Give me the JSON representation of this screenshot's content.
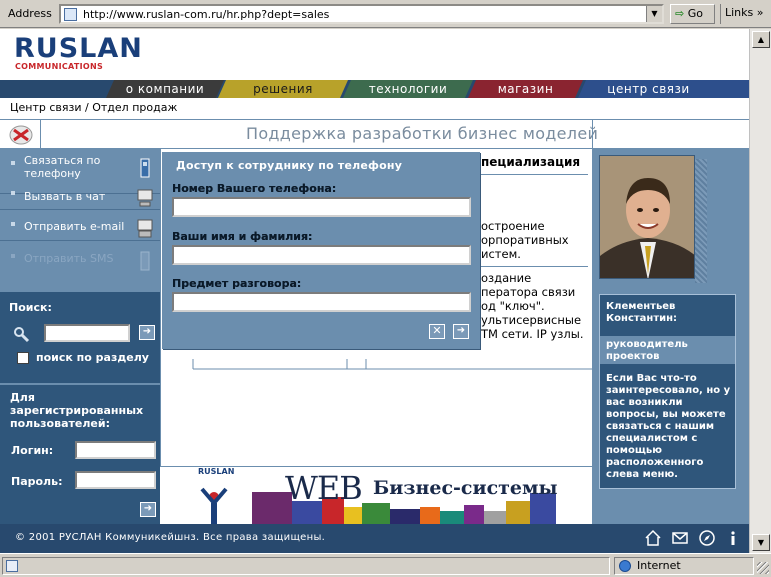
{
  "browser": {
    "address_label": "Address",
    "url": "http://www.ruslan-com.ru/hr.php?dept=sales",
    "go_label": "Go",
    "links_label": "Links",
    "status_text": "",
    "zone_label": "Internet"
  },
  "header": {
    "logo_main": "RUSLAN",
    "logo_sub": "COMMUNICATIONS"
  },
  "nav": {
    "tabs": [
      {
        "label": "о компании",
        "color": "#3b3b3b"
      },
      {
        "label": "решения",
        "color": "#b8a22a"
      },
      {
        "label": "технологии",
        "color": "#3d6b4e"
      },
      {
        "label": "магазин",
        "color": "#8a2430"
      },
      {
        "label": "центр связи",
        "color": "#2d4f8c"
      }
    ]
  },
  "breadcrumb": "Центр связи / Отдел продаж",
  "page_title": "Поддержка разработки бизнес моделей",
  "sidebar": {
    "links": [
      {
        "label": "Связаться по телефону"
      },
      {
        "label": "Вызвать в чат"
      },
      {
        "label": "Отправить e-mail"
      },
      {
        "label": "Отправить SMS"
      }
    ],
    "search": {
      "label": "Поиск:",
      "value": "",
      "section_label": "поиск по разделу"
    },
    "login": {
      "title": "Для зарегистрированных пользователей:",
      "login_label": "Логин:",
      "password_label": "Пароль:"
    }
  },
  "popup": {
    "title": "Доступ к сотруднику по телефону",
    "phone_label": "Номер Вашего телефона:",
    "name_label": "Ваши имя и фамилия:",
    "subject_label": "Предмет разговора:",
    "phone_value": "",
    "name_value": "",
    "subject_value": ""
  },
  "specialization": {
    "header": "пециализация",
    "item1": "остроение орпоративных истем.",
    "item2": "оздание ператора связи од \"ключ\". ультисервисные ТМ сети. IP узлы."
  },
  "banner": {
    "logo": "RUSLAN",
    "web": "WEB",
    "biz": "Бизнес-системы"
  },
  "contact": {
    "name": "Клементьев Константин:",
    "role": "руководитель проектов",
    "description": "Если Вас что-то заинтересовало, но у вас возникли вопросы, вы можете связаться с нашим специалистом с помощью расположенного слева меню."
  },
  "footer": {
    "copyright": "© 2001 РУСЛАН Коммуникейшнз. Все права защищены."
  }
}
